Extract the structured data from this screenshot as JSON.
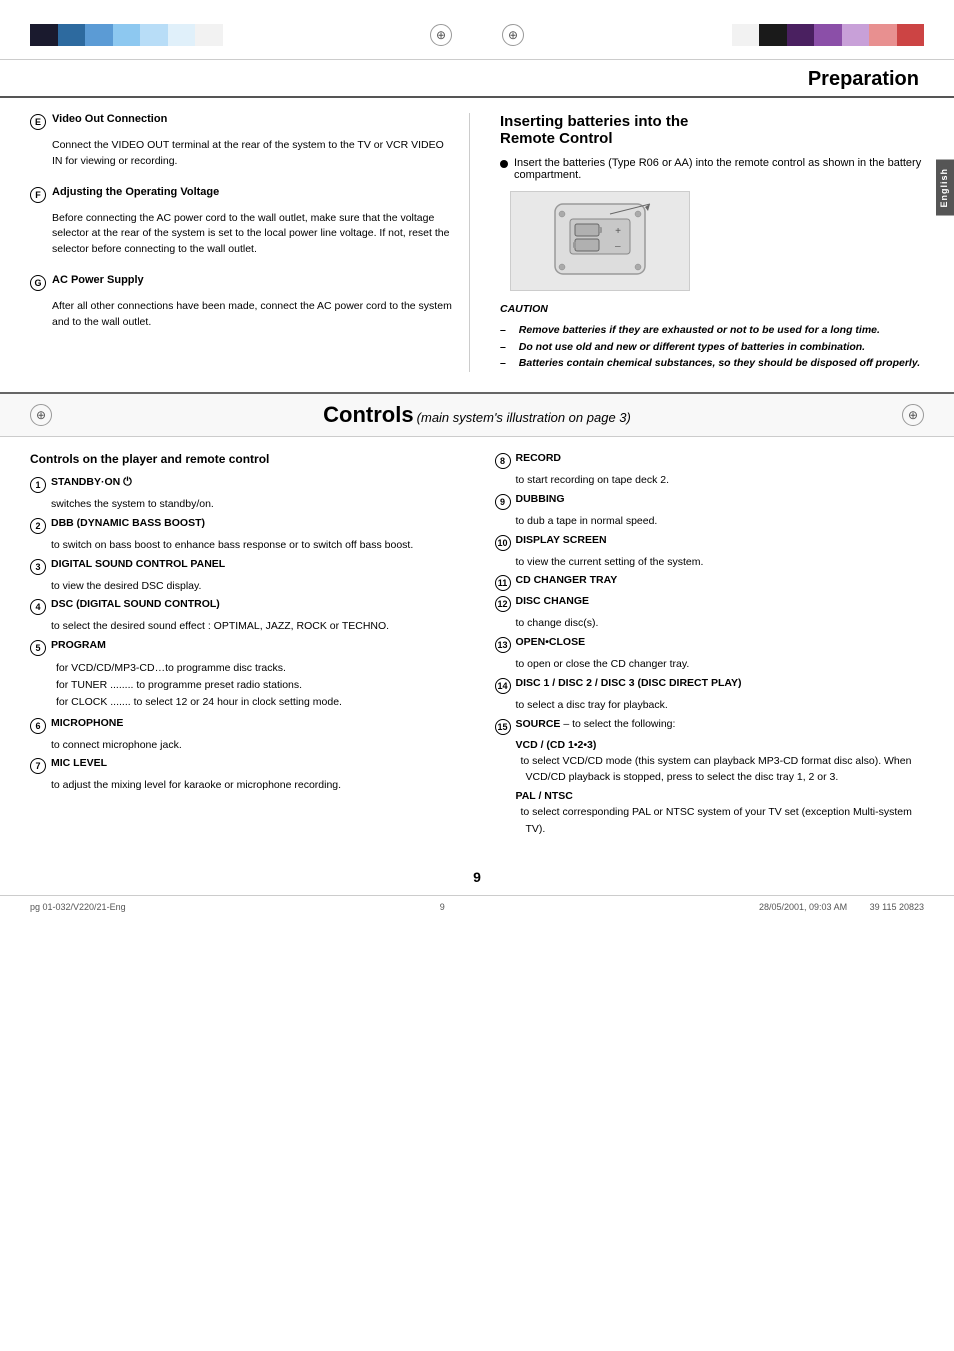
{
  "page": {
    "title": "Preparation",
    "page_number": "9"
  },
  "top_bar_left": {
    "colors": [
      "#1a1a2e",
      "#2d6a9f",
      "#5b9bd5",
      "#8dc8f0",
      "#b8ddf7",
      "#e8f4fc",
      "#f5f5f5",
      "#ffffff"
    ]
  },
  "top_bar_right": {
    "colors": [
      "#1a1a1a",
      "#4a2060",
      "#8b4fa8",
      "#c8a0d8",
      "#f0d8f5",
      "#f5c0e8",
      "#e89090",
      "#cc4444"
    ]
  },
  "left_column": {
    "sections": [
      {
        "letter": "E",
        "title": "Video Out Connection",
        "body": "Connect the VIDEO OUT terminal at the rear of the system to the TV or VCR VIDEO IN for viewing or recording."
      },
      {
        "letter": "F",
        "title": "Adjusting the Operating Voltage",
        "body": "Before connecting the AC power cord to the wall outlet, make sure that the voltage selector at the rear of the system is set to the local power line voltage. If not, reset the selector before connecting to the wall outlet."
      },
      {
        "letter": "G",
        "title": "AC Power Supply",
        "body": "After all other connections have been made, connect the AC power cord to the system and to the wall outlet."
      }
    ]
  },
  "right_column": {
    "heading_line1": "Inserting batteries into the",
    "heading_line2": "Remote Control",
    "bullet_text": "Insert the batteries (Type R06 or AA) into the remote control as shown in the battery compartment.",
    "caution_title": "CAUTION",
    "caution_items": [
      "Remove batteries if they are exhausted or not to be used for a long time.",
      "Do not use old and new or different types of batteries in combination.",
      "Batteries contain chemical substances, so they should be disposed off properly."
    ]
  },
  "english_tab": "English",
  "controls": {
    "title": "Controls",
    "subtitle": "(main system's illustration on page 3)",
    "left_section_title": "Controls on the player and remote control",
    "items_left": [
      {
        "number": "1",
        "label": "STANDBY·ON ⏻",
        "desc": "switches the system to standby/on."
      },
      {
        "number": "2",
        "label": "DBB (DYNAMIC BASS BOOST)",
        "desc": "to switch on bass boost to enhance bass response or to switch off bass boost."
      },
      {
        "number": "3",
        "label": "DIGITAL SOUND CONTROL PANEL",
        "desc": "to view the desired DSC display."
      },
      {
        "number": "4",
        "label": "DSC (DIGITAL SOUND CONTROL)",
        "desc": "to select the desired sound effect : OPTIMAL,  JAZZ,  ROCK or TECHNO."
      },
      {
        "number": "5",
        "label": "PROGRAM",
        "sub_descs": [
          "for VCD/CD/MP3-CD…to programme disc tracks.",
          "for TUNER ........ to programme preset radio stations.",
          "for CLOCK ....... to select 12 or 24 hour in clock setting mode."
        ]
      },
      {
        "number": "6",
        "label": "MICROPHONE",
        "desc": "to connect microphone jack."
      },
      {
        "number": "7",
        "label": "MIC LEVEL",
        "desc": "to adjust the mixing level for karaoke or microphone recording."
      }
    ],
    "items_right": [
      {
        "number": "8",
        "label": "RECORD",
        "desc": "to start recording on tape deck 2."
      },
      {
        "number": "9",
        "label": "DUBBING",
        "desc": "to dub a tape in normal speed."
      },
      {
        "number": "10",
        "label": "DISPLAY SCREEN",
        "desc": "to view the current setting of the system."
      },
      {
        "number": "11",
        "label": "CD CHANGER TRAY",
        "desc": ""
      },
      {
        "number": "12",
        "label": "DISC CHANGE",
        "desc": "to change disc(s)."
      },
      {
        "number": "13",
        "label": "OPEN•CLOSE",
        "desc": "to open or close the CD changer tray."
      },
      {
        "number": "14",
        "label": "DISC 1 / DISC 2 / DISC 3 (DISC DIRECT PLAY)",
        "desc": "to select a disc tray for playback."
      },
      {
        "number": "15",
        "label": "SOURCE",
        "label_suffix": " – to select the following:",
        "sub_section": "VCD / (CD 1•2•3)",
        "sub_desc": "to select VCD/CD mode (this system can playback MP3-CD format disc also). When VCD/CD playback is stopped, press to select the disc tray 1, 2 or 3.",
        "sub_section2": "PAL / NTSC",
        "sub_desc2": "to select corresponding PAL or NTSC system of your TV set (exception Multi-system TV)."
      }
    ]
  },
  "footer": {
    "left": "pg 01-032/V220/21-Eng",
    "center": "9",
    "right": "28/05/2001, 09:03 AM",
    "right2": "39 115 20823"
  }
}
